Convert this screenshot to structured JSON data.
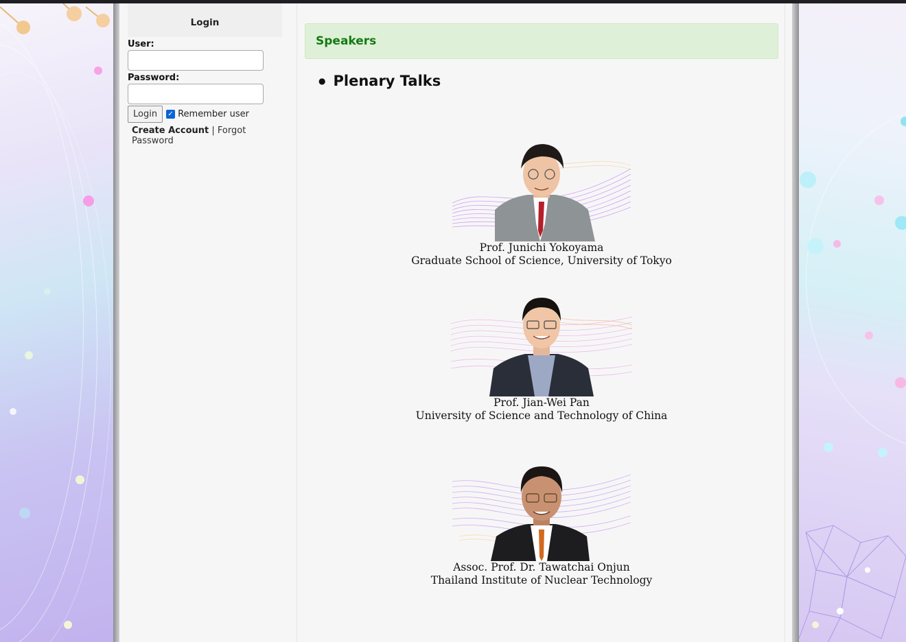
{
  "login": {
    "title": "Login",
    "user_label": "User:",
    "password_label": "Password:",
    "button_label": "Login",
    "remember_label": "Remember user",
    "remember_checked": true,
    "create_account": "Create Account",
    "separator": "|",
    "forgot_password": "Forgot Password"
  },
  "main": {
    "section_header": "Speakers",
    "heading": "Plenary Talks",
    "speakers": [
      {
        "name": "Prof. Junichi Yokoyama",
        "affiliation": "Graduate School of Science, University of Tokyo"
      },
      {
        "name": "Prof. Jian-Wei Pan",
        "affiliation": "University of Science and Technology of China"
      },
      {
        "name": "Assoc. Prof. Dr. Tawatchai Onjun",
        "affiliation": "Thailand Institute of Nuclear Technology"
      }
    ]
  },
  "colors": {
    "header_green": "#137a13",
    "header_bg": "#dff0d8",
    "checkbox_blue": "#0a64d6"
  }
}
